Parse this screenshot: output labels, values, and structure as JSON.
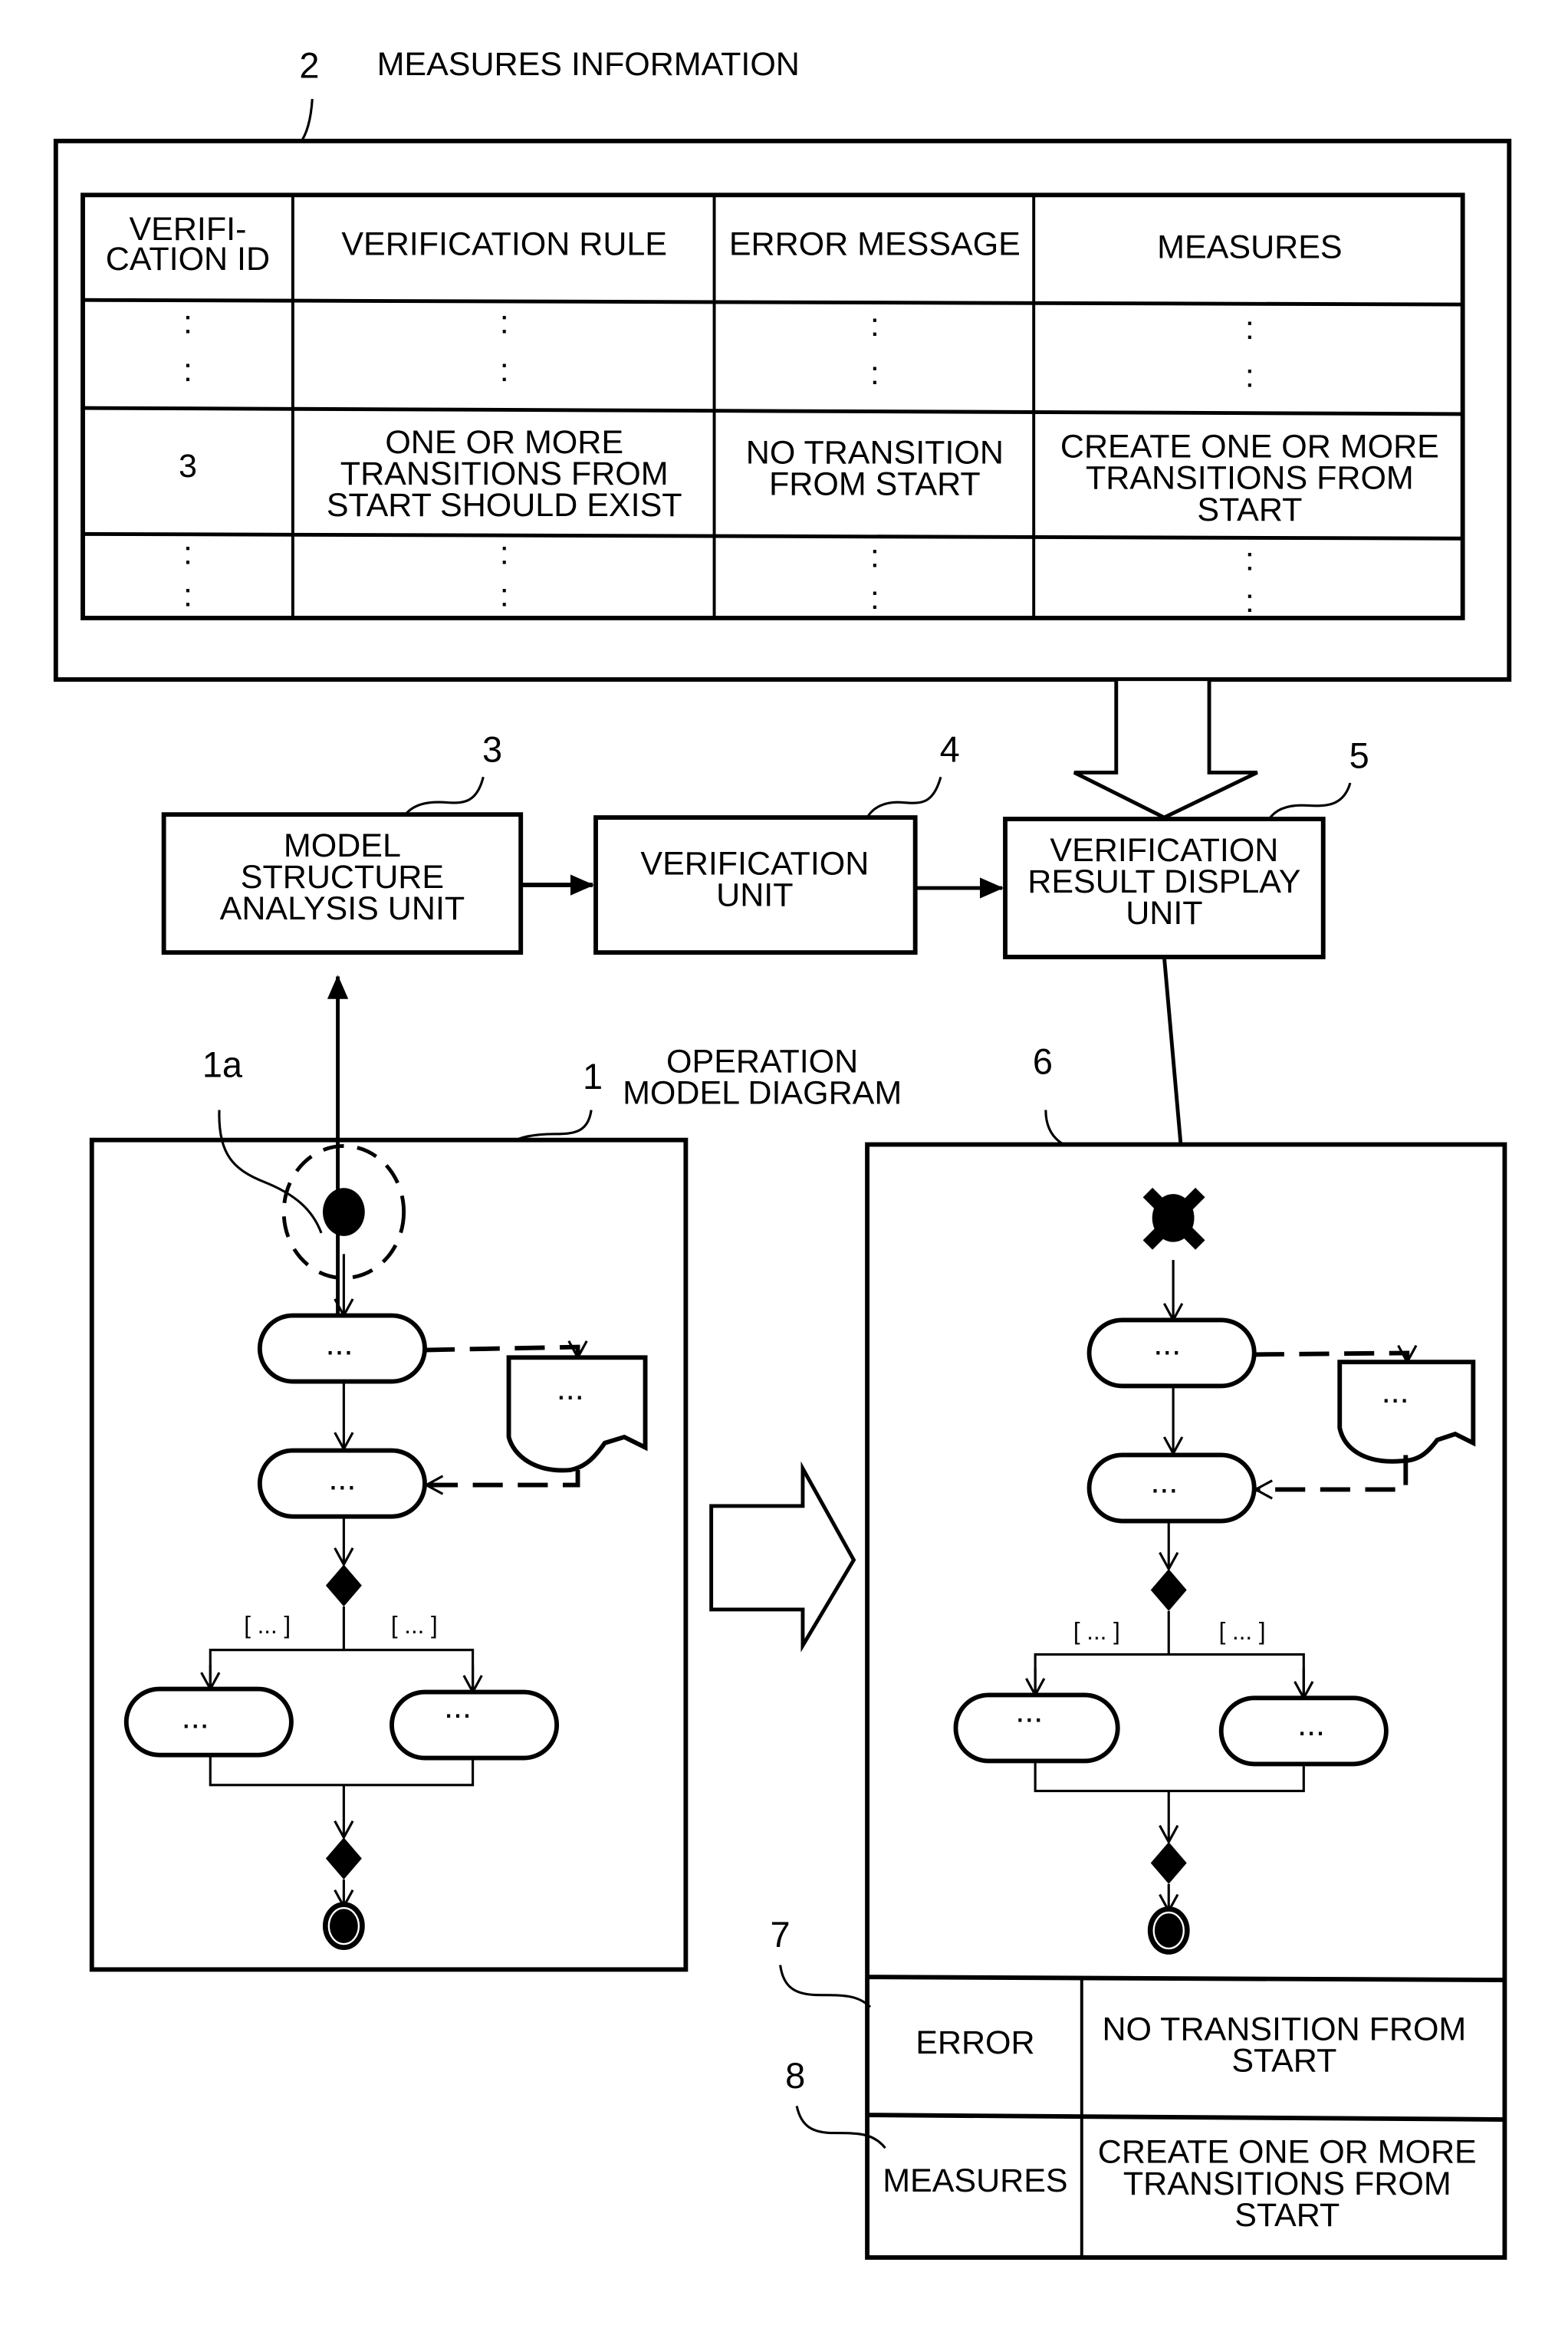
{
  "figure": {
    "measures_info": {
      "ref": "2",
      "title": "MEASURES INFORMATION",
      "columns": [
        "VERIFI-",
        "CATION ID",
        "VERIFICATION RULE",
        "ERROR MESSAGE",
        "MEASURES"
      ],
      "ellipsis": ":",
      "row": {
        "id": "3",
        "rule": [
          "ONE OR MORE",
          "TRANSITIONS FROM",
          "START SHOULD EXIST"
        ],
        "error": [
          "NO TRANSITION",
          "FROM START"
        ],
        "measures": [
          "CREATE ONE OR MORE",
          "TRANSITIONS FROM",
          "START"
        ]
      }
    },
    "units": {
      "model_structure": {
        "ref": "3",
        "lines": [
          "MODEL",
          "STRUCTURE",
          "ANALYSIS UNIT"
        ]
      },
      "verification": {
        "ref": "4",
        "lines": [
          "VERIFICATION",
          "UNIT"
        ]
      },
      "result_display": {
        "ref": "5",
        "lines": [
          "VERIFICATION",
          "RESULT DISPLAY",
          "UNIT"
        ]
      }
    },
    "operation_model": {
      "ref": "1",
      "start_ref": "1a",
      "title": [
        "OPERATION",
        "MODEL DIAGRAM"
      ],
      "node_text": "...",
      "guard_text": "[ ... ]"
    },
    "result_view": {
      "ref": "6",
      "error_ref": "7",
      "measures_ref": "8",
      "error_label": "ERROR",
      "error_text": [
        "NO TRANSITION FROM",
        "START"
      ],
      "measures_label": "MEASURES",
      "measures_text": [
        "CREATE ONE OR MORE",
        "TRANSITIONS FROM",
        "START"
      ]
    }
  }
}
